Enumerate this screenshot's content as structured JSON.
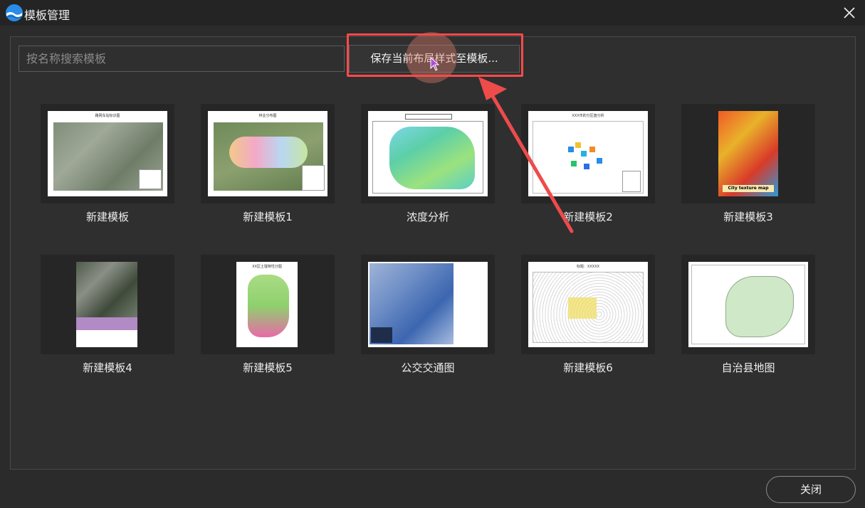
{
  "window": {
    "title": "模板管理"
  },
  "search": {
    "placeholder": "按名称搜索模板"
  },
  "toolbar": {
    "save_label": "保存当前布局样式至模板..."
  },
  "templates": [
    {
      "name": "新建模板",
      "thumb_title": "路网车站标识图"
    },
    {
      "name": "新建模板1",
      "thumb_title": "林业分布图"
    },
    {
      "name": "浓度分析",
      "thumb_title": ""
    },
    {
      "name": "新建模板2",
      "thumb_title": "XXX市的分区盘分析"
    },
    {
      "name": "新建模板3",
      "thumb_title": "City texture map"
    },
    {
      "name": "新建模板4",
      "thumb_title": ""
    },
    {
      "name": "新建模板5",
      "thumb_title": "XX区土壤特性分图"
    },
    {
      "name": "公交交通图",
      "thumb_title": ""
    },
    {
      "name": "新建模板6",
      "thumb_title": "标题：XXXXX"
    },
    {
      "name": "自治县地图",
      "thumb_title": ""
    }
  ],
  "footer": {
    "close_label": "关闭"
  },
  "colors": {
    "highlight": "#ff4a4a",
    "background": "#2b2b2b",
    "card": "#262626"
  }
}
